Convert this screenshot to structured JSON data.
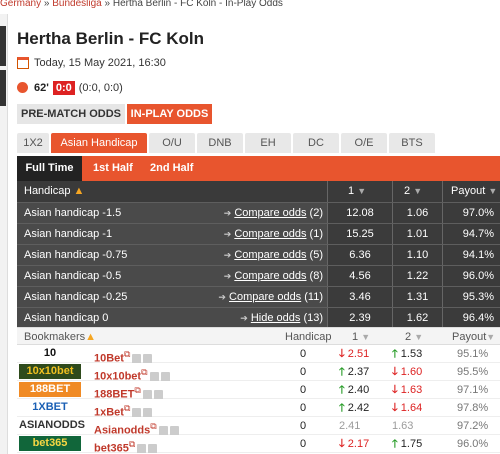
{
  "breadcrumb": {
    "country": "Germany",
    "sep1": "»",
    "league": "Bundesliga",
    "sep2": "»",
    "current": "Hertha Berlin - FC Koln - In-Play Odds"
  },
  "match": {
    "title": "Hertha Berlin - FC Koln",
    "date": "Today, 15 May 2021, 16:30",
    "minute": "62'",
    "score": "0:0",
    "halftime": "(0:0, 0:0)"
  },
  "mode": {
    "prematch": "PRE-MATCH ODDS",
    "inplay": "IN-PLAY ODDS"
  },
  "tabs": [
    "1X2",
    "Asian Handicap",
    "O/U",
    "DNB",
    "EH",
    "DC",
    "O/E",
    "BTS"
  ],
  "periods": [
    "Full Time",
    "1st Half",
    "2nd Half"
  ],
  "table_header": {
    "handicap": "Handicap",
    "col1": "1",
    "col2": "2",
    "payout": "Payout"
  },
  "handicaps": [
    {
      "label": "Asian handicap -1.5",
      "link": "Compare odds",
      "count": "(2)",
      "o1": "12.08",
      "o2": "1.06",
      "payout": "97.0%"
    },
    {
      "label": "Asian handicap -1",
      "link": "Compare odds",
      "count": "(1)",
      "o1": "15.25",
      "o2": "1.01",
      "payout": "94.7%"
    },
    {
      "label": "Asian handicap -0.75",
      "link": "Compare odds",
      "count": "(5)",
      "o1": "6.36",
      "o2": "1.10",
      "payout": "94.1%"
    },
    {
      "label": "Asian handicap -0.5",
      "link": "Compare odds",
      "count": "(8)",
      "o1": "4.56",
      "o2": "1.22",
      "payout": "96.0%"
    },
    {
      "label": "Asian handicap -0.25",
      "link": "Compare odds",
      "count": "(11)",
      "o1": "3.46",
      "o2": "1.31",
      "payout": "95.3%"
    },
    {
      "label": "Asian handicap 0",
      "link": "Hide odds",
      "count": "(13)",
      "o1": "2.39",
      "o2": "1.62",
      "payout": "96.4%"
    }
  ],
  "bookmakers_header": {
    "bookmakers": "Bookmakers",
    "handicap": "Handicap",
    "col1": "1",
    "col2": "2",
    "payout": "Payout"
  },
  "bookmakers": [
    {
      "logo": "10",
      "name": "10Bet",
      "handicap": "0",
      "o1": "2.51",
      "o1_dir": "down",
      "o2": "1.53",
      "o2_dir": "up",
      "payout": "95.1%",
      "logo_color": "#111",
      "logo_bg": "#fff"
    },
    {
      "logo": "10x10bet",
      "name": "10x10bet",
      "handicap": "0",
      "o1": "2.37",
      "o1_dir": "up",
      "o2": "1.60",
      "o2_dir": "down",
      "payout": "95.5%",
      "logo_color": "#f0c020",
      "logo_bg": "#2e4a1c"
    },
    {
      "logo": "188BET",
      "name": "188BET",
      "handicap": "0",
      "o1": "2.40",
      "o1_dir": "up",
      "o2": "1.63",
      "o2_dir": "down",
      "payout": "97.1%",
      "logo_color": "#fff",
      "logo_bg": "#f08a24"
    },
    {
      "logo": "1XBET",
      "name": "1xBet",
      "handicap": "0",
      "o1": "2.42",
      "o1_dir": "up",
      "o2": "1.64",
      "o2_dir": "down",
      "payout": "97.8%",
      "logo_color": "#1a5fb4",
      "logo_bg": "#fff"
    },
    {
      "logo": "ASIANODDS",
      "name": "Asianodds",
      "handicap": "0",
      "o1": "2.41",
      "o1_dir": "none",
      "o2": "1.63",
      "o2_dir": "none",
      "payout": "97.2%",
      "logo_color": "#333",
      "logo_bg": "#fff"
    },
    {
      "logo": "bet365",
      "name": "bet365",
      "handicap": "0",
      "o1": "2.17",
      "o1_dir": "down",
      "o2": "1.75",
      "o2_dir": "up",
      "payout": "96.0%",
      "logo_color": "#f6d743",
      "logo_bg": "#11663a"
    }
  ],
  "colors": {
    "accent": "#e8552e",
    "dark": "#3a3a3a",
    "link_red": "#c0392b",
    "up": "#2a9d2a",
    "down": "#dd2222"
  }
}
